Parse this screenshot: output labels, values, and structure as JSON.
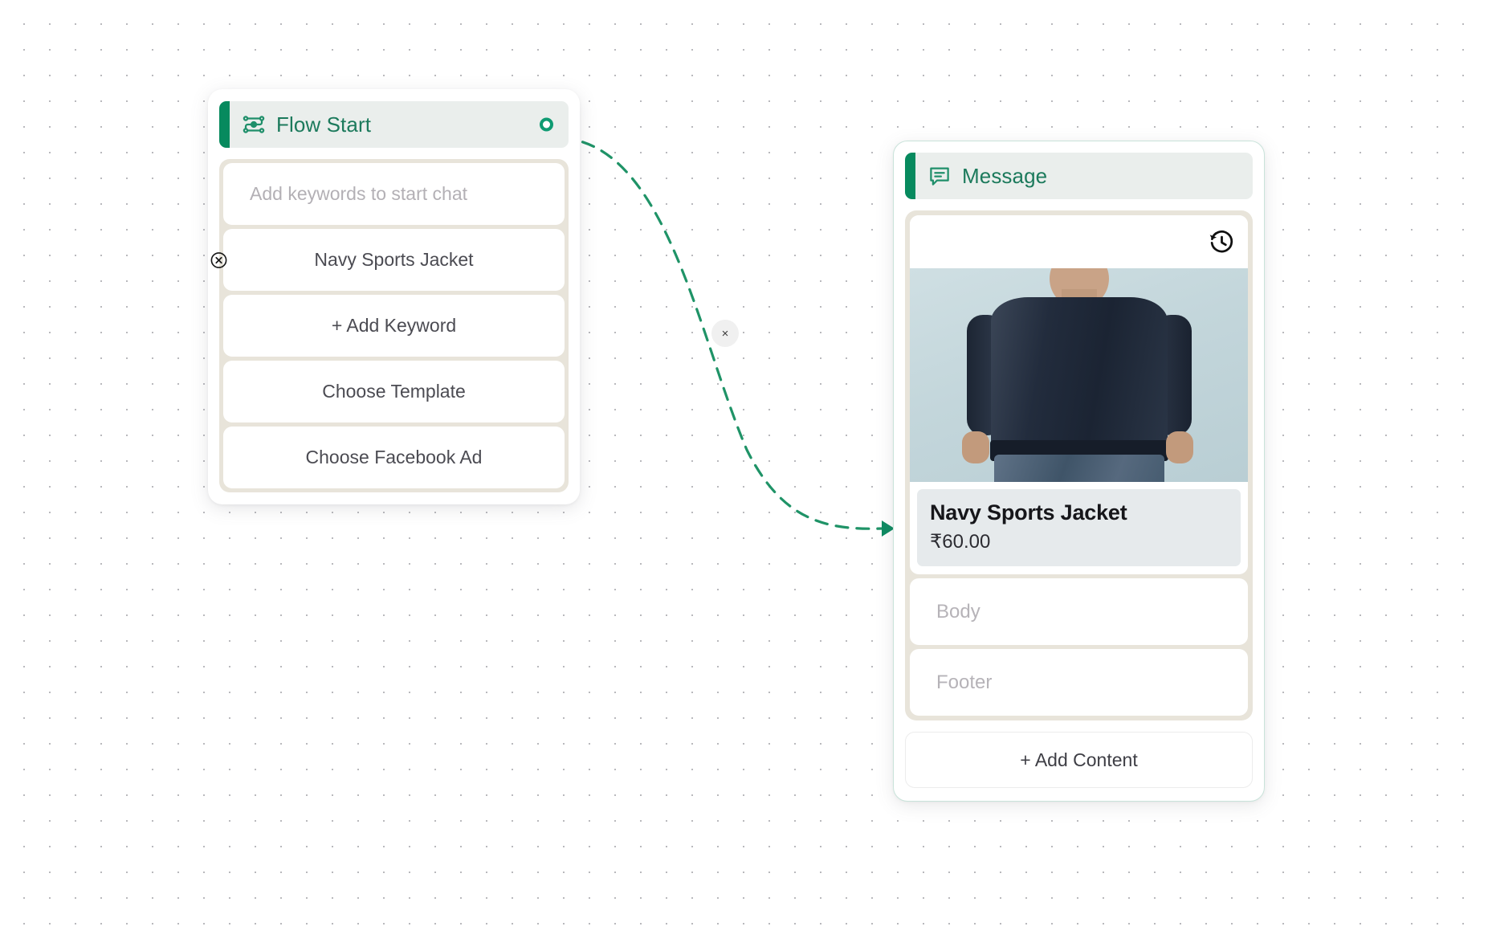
{
  "canvas": {
    "background_color": "#ffffff",
    "dot_color": "#b9b9bd",
    "accent_color": "#078a5e",
    "edge_color": "#1f9367"
  },
  "edge": {
    "delete_label": "×",
    "style": "dashed-curve"
  },
  "flow_start_node": {
    "header": {
      "title": "Flow Start",
      "icon": "flow-icon",
      "accent_color": "#078a5e",
      "port": "output-port"
    },
    "keyword_input": {
      "placeholder": "Add keywords to start chat",
      "value": ""
    },
    "keywords": [
      {
        "label": "Navy Sports Jacket",
        "remove_icon": "⊗"
      }
    ],
    "buttons": [
      {
        "label": "+ Add Keyword",
        "name": "add-keyword-button"
      },
      {
        "label": "Choose Template",
        "name": "choose-template-button"
      },
      {
        "label": "Choose Facebook Ad",
        "name": "choose-facebook-ad-button"
      }
    ]
  },
  "message_node": {
    "header": {
      "title": "Message",
      "icon": "message-icon",
      "accent_color": "#078a5e"
    },
    "media": {
      "history_icon": "history-icon",
      "image_alt": "Navy bomber jacket worn by a model, back view"
    },
    "product": {
      "title": "Navy Sports Jacket",
      "price": "₹60.00"
    },
    "fields": [
      {
        "placeholder": "Body",
        "value": "",
        "name": "body-field"
      },
      {
        "placeholder": "Footer",
        "value": "",
        "name": "footer-field"
      }
    ],
    "add_content_button": {
      "label": "+ Add Content"
    }
  }
}
